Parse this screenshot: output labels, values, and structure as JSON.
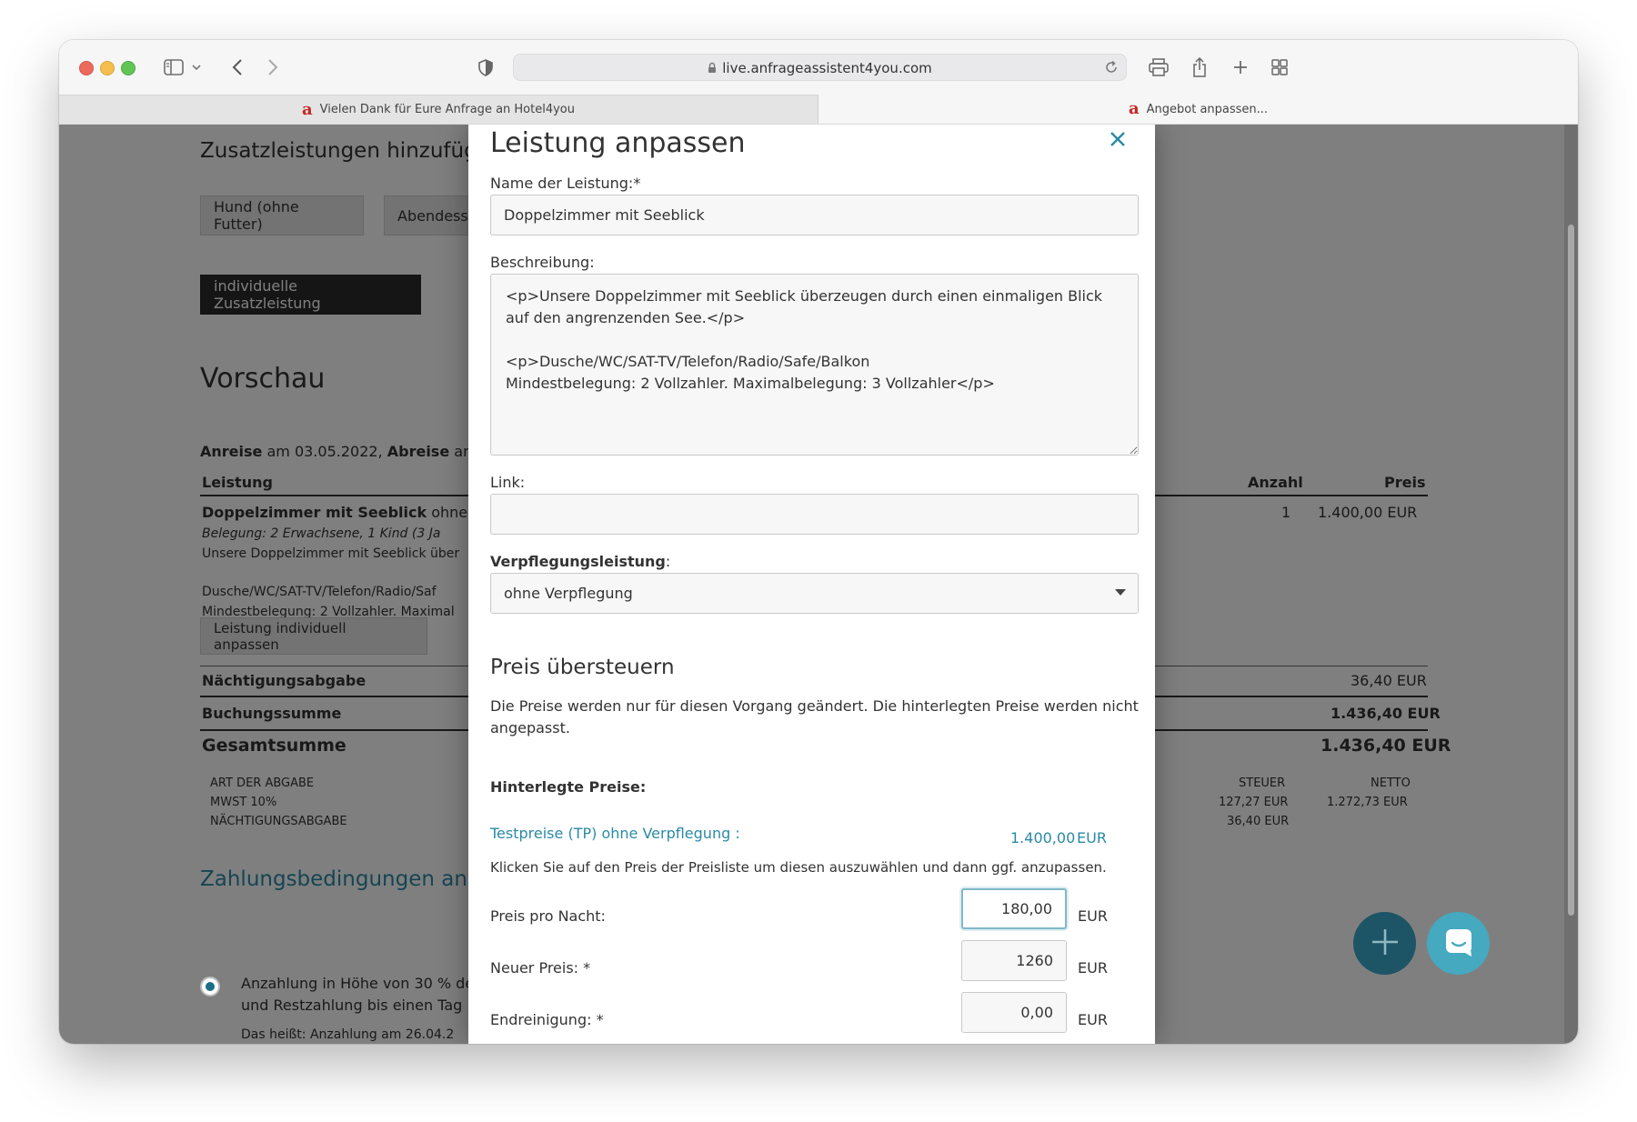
{
  "browser": {
    "url": "live.anfrageassistent4you.com",
    "tabs": [
      {
        "label": "Vielen Dank für Eure Anfrage an Hotel4you",
        "favicon": "a"
      },
      {
        "label": "Angebot anpassen...",
        "favicon": "a"
      }
    ]
  },
  "background": {
    "extras_heading": "Zusatzleistungen hinzufügen",
    "extra_buttons": [
      "Hund (ohne Futter)",
      "Abendess"
    ],
    "custom_extra_button": "individuelle Zusatzleistung",
    "preview_heading": "Vorschau",
    "arrival": {
      "anreise_label": "Anreise",
      "am": "am 03.05.2022,",
      "abreise_label": "Abreise",
      "am2": "am"
    },
    "table": {
      "col_leistung": "Leistung",
      "col_anzahl": "Anzahl",
      "col_preis": "Preis",
      "item_name": "Doppelzimmer mit Seeblick",
      "item_suffix": "ohne V",
      "item_belegung": "Belegung: 2 Erwachsene, 1 Kind (3 Ja",
      "item_desc1": "Unsere Doppelzimmer mit Seeblick über",
      "item_desc2": "Dusche/WC/SAT-TV/Telefon/Radio/Saf",
      "item_desc3": "Mindestbelegung: 2 Vollzahler. Maximal",
      "item_anzahl": "1",
      "item_preis": "1.400,00 EUR",
      "adjust_button": "Leistung individuell anpassen",
      "tax_label": "Nächtigungsabgabe",
      "tax_value": "36,40 EUR",
      "booking_label": "Buchungssumme",
      "booking_value": "1.436,40 EUR",
      "total_label": "Gesamtsumme",
      "total_value": "1.436,40 EUR"
    },
    "tax_table": {
      "col_type": "ART DER ABGABE",
      "col_steuer": "STEUER",
      "col_netto": "NETTO",
      "row1_type": "MWST 10%",
      "row1_steuer": "127,27 EUR",
      "row1_netto": "1.272,73 EUR",
      "row2_type": "NÄCHTIGUNGSABGABE",
      "row2_steuer": "36,40 EUR"
    },
    "payment_heading": "Zahlungsbedingungen anpas",
    "payment_option_line1": "Anzahlung in Höhe von 30 % de",
    "payment_option_line2": "und Restzahlung bis einen Tag",
    "payment_option_line3": "Das heißt: Anzahlung am 26.04.2"
  },
  "modal": {
    "title": "Leistung anpassen",
    "name_label": "Name der Leistung:*",
    "name_value": "Doppelzimmer mit Seeblick",
    "description_label": "Beschreibung:",
    "description_value": "<p>Unsere Doppelzimmer mit Seeblick überzeugen durch einen einmaligen Blick auf den angrenzenden See.</p>\n\n<p>Dusche/WC/SAT-TV/Telefon/Radio/Safe/Balkon\nMindestbelegung: 2 Vollzahler. Maximalbelegung: 3 Vollzahler</p>",
    "link_label": "Link:",
    "link_value": "",
    "meal_label": "Verpflegungsleistung",
    "meal_colon": ":",
    "meal_value": "ohne Verpflegung",
    "price_heading": "Preis übersteuern",
    "price_info": "Die Preise werden nur für diesen Vorgang geändert. Die hinterlegten Preise werden nicht angepasst.",
    "stored_prices_label": "Hinterlegte Preise:",
    "price_list_item": "Testpreise (TP) ohne Verpflegung :",
    "price_list_value": "1.400,00",
    "price_list_currency": "EUR",
    "price_list_hint": "Klicken Sie auf den Preis der Preisliste um diesen auszuwählen und dann ggf. anzupassen.",
    "per_night_label": "Preis pro Nacht:",
    "per_night_value": "180,00",
    "new_price_label": "Neuer Preis: *",
    "new_price_value": "1260",
    "cleaning_label": "Endreinigung: *",
    "cleaning_value": "0,00",
    "currency": "EUR"
  },
  "colors": {
    "accent": "#2a8aa5",
    "fab_dark": "#1d5566",
    "fab_light": "#45a9bf"
  },
  "icons": [
    "sidebar-icon",
    "chevron-down-icon",
    "back-arrow-icon",
    "forward-arrow-icon",
    "shield-icon",
    "lock-icon",
    "reload-icon",
    "print-icon",
    "share-icon",
    "plus-icon",
    "tab-grid-icon",
    "close-icon",
    "caret-down-icon",
    "add-icon",
    "chat-icon"
  ]
}
